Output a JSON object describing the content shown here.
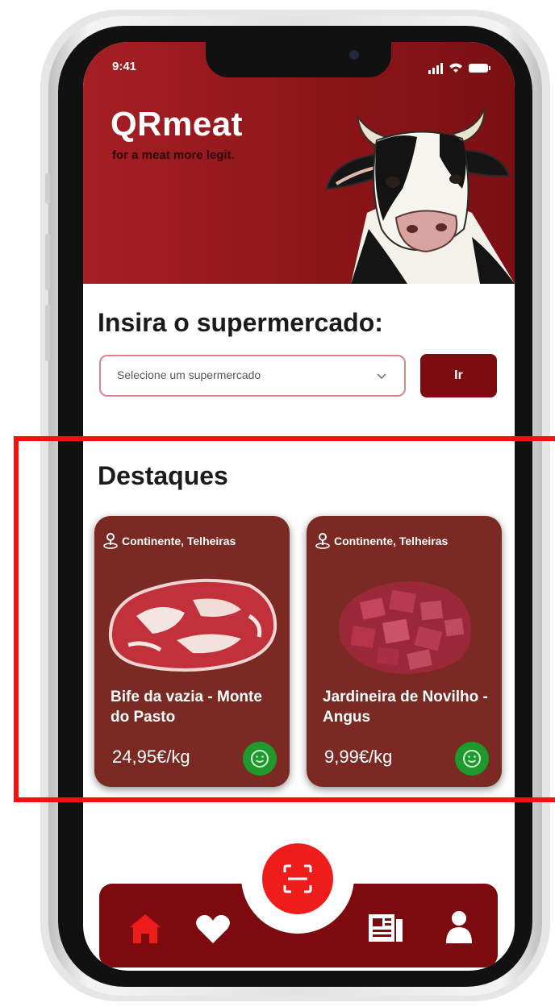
{
  "status_bar": {
    "time": "9:41"
  },
  "header": {
    "title": "QRmeat",
    "tagline": "for a meat more legit."
  },
  "supermarket": {
    "heading": "Insira o supermercado:",
    "select_value": "Selecione um supermercado",
    "go_label": "Ir"
  },
  "highlights": {
    "heading": "Destaques",
    "cards": [
      {
        "location": "Continente, Telheiras",
        "name": "Bife da vazia - Monte do Pasto",
        "price": "24,95€/kg"
      },
      {
        "location": "Continente, Telheiras",
        "name": "Jardineira de Novilho - Angus",
        "price": "9,99€/kg"
      }
    ]
  },
  "nav": {
    "items": [
      "home-icon",
      "heart-icon",
      "scan-icon",
      "newspaper-icon",
      "user-icon"
    ],
    "active": "home-icon"
  },
  "colors": {
    "brand_red": "#8c1519",
    "card_bg": "#7a2a23",
    "accent_red": "#ef1c1c",
    "badge_green": "#1d9a2b",
    "highlight": "#ff0d0d"
  }
}
